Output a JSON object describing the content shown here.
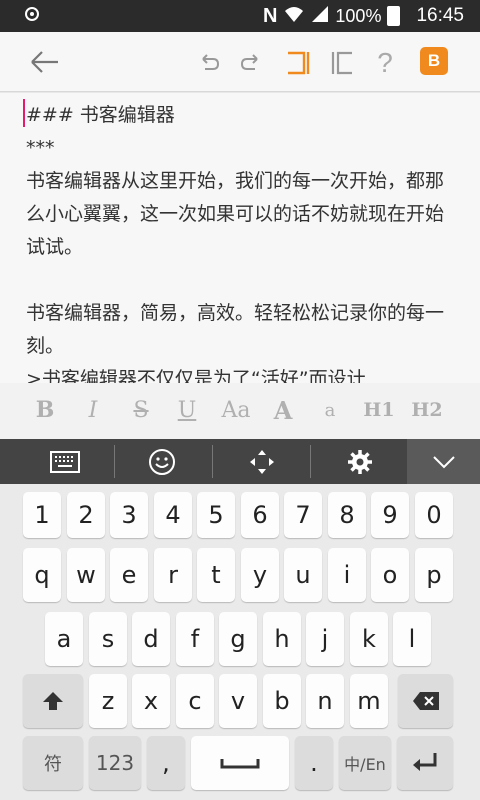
{
  "status_bar": {
    "battery": "100%",
    "time": "16:45"
  },
  "toolbar": {
    "help_label": "?",
    "brand_label": "B"
  },
  "editor": {
    "lines": [
      "### 书客编辑器",
      "***",
      "书客编辑器从这里开始，我们的每一次开始，都那",
      "么小心翼翼，这一次如果可以的话不妨就现在开始",
      "试试。",
      "",
      "书客编辑器，简易，高效。轻轻松松记录你的每一",
      "刻。",
      ">书客编辑器不仅仅是为了“活好”而设计"
    ]
  },
  "format_bar": {
    "bold": "B",
    "italic": "I",
    "strike": "S",
    "underline": "U",
    "font_size": "Aa",
    "capital": "A",
    "small": "a",
    "h1": "H1",
    "h2": "H2"
  },
  "keyboard": {
    "numbers": [
      "1",
      "2",
      "3",
      "4",
      "5",
      "6",
      "7",
      "8",
      "9",
      "0"
    ],
    "row1": [
      "q",
      "w",
      "e",
      "r",
      "t",
      "y",
      "u",
      "i",
      "o",
      "p"
    ],
    "row1_hints": [
      "",
      "",
      "",
      "",
      "",
      "",
      "",
      "",
      "",
      "%"
    ],
    "row2": [
      "a",
      "s",
      "d",
      "f",
      "g",
      "h",
      "j",
      "k",
      "l"
    ],
    "row2_hints": [
      "",
      "",
      "",
      "(",
      "",
      "",
      "",
      "",
      "/"
    ],
    "row3": [
      "z",
      "x",
      "c",
      "v",
      "b",
      "n",
      "m"
    ],
    "row3_hints": [
      "",
      "",
      "",
      "",
      "¥",
      "",
      "$"
    ],
    "row1_top_hints": [
      "",
      "",
      "",
      "",
      "",
      "",
      "",
      "",
      "",
      ""
    ],
    "symbol_key": "符",
    "num_key": "123",
    "comma_key": ",",
    "period_key": ".",
    "lang_key": "中/En"
  },
  "colors": {
    "accent": "#f08a1e",
    "cursor": "#e6196a"
  }
}
